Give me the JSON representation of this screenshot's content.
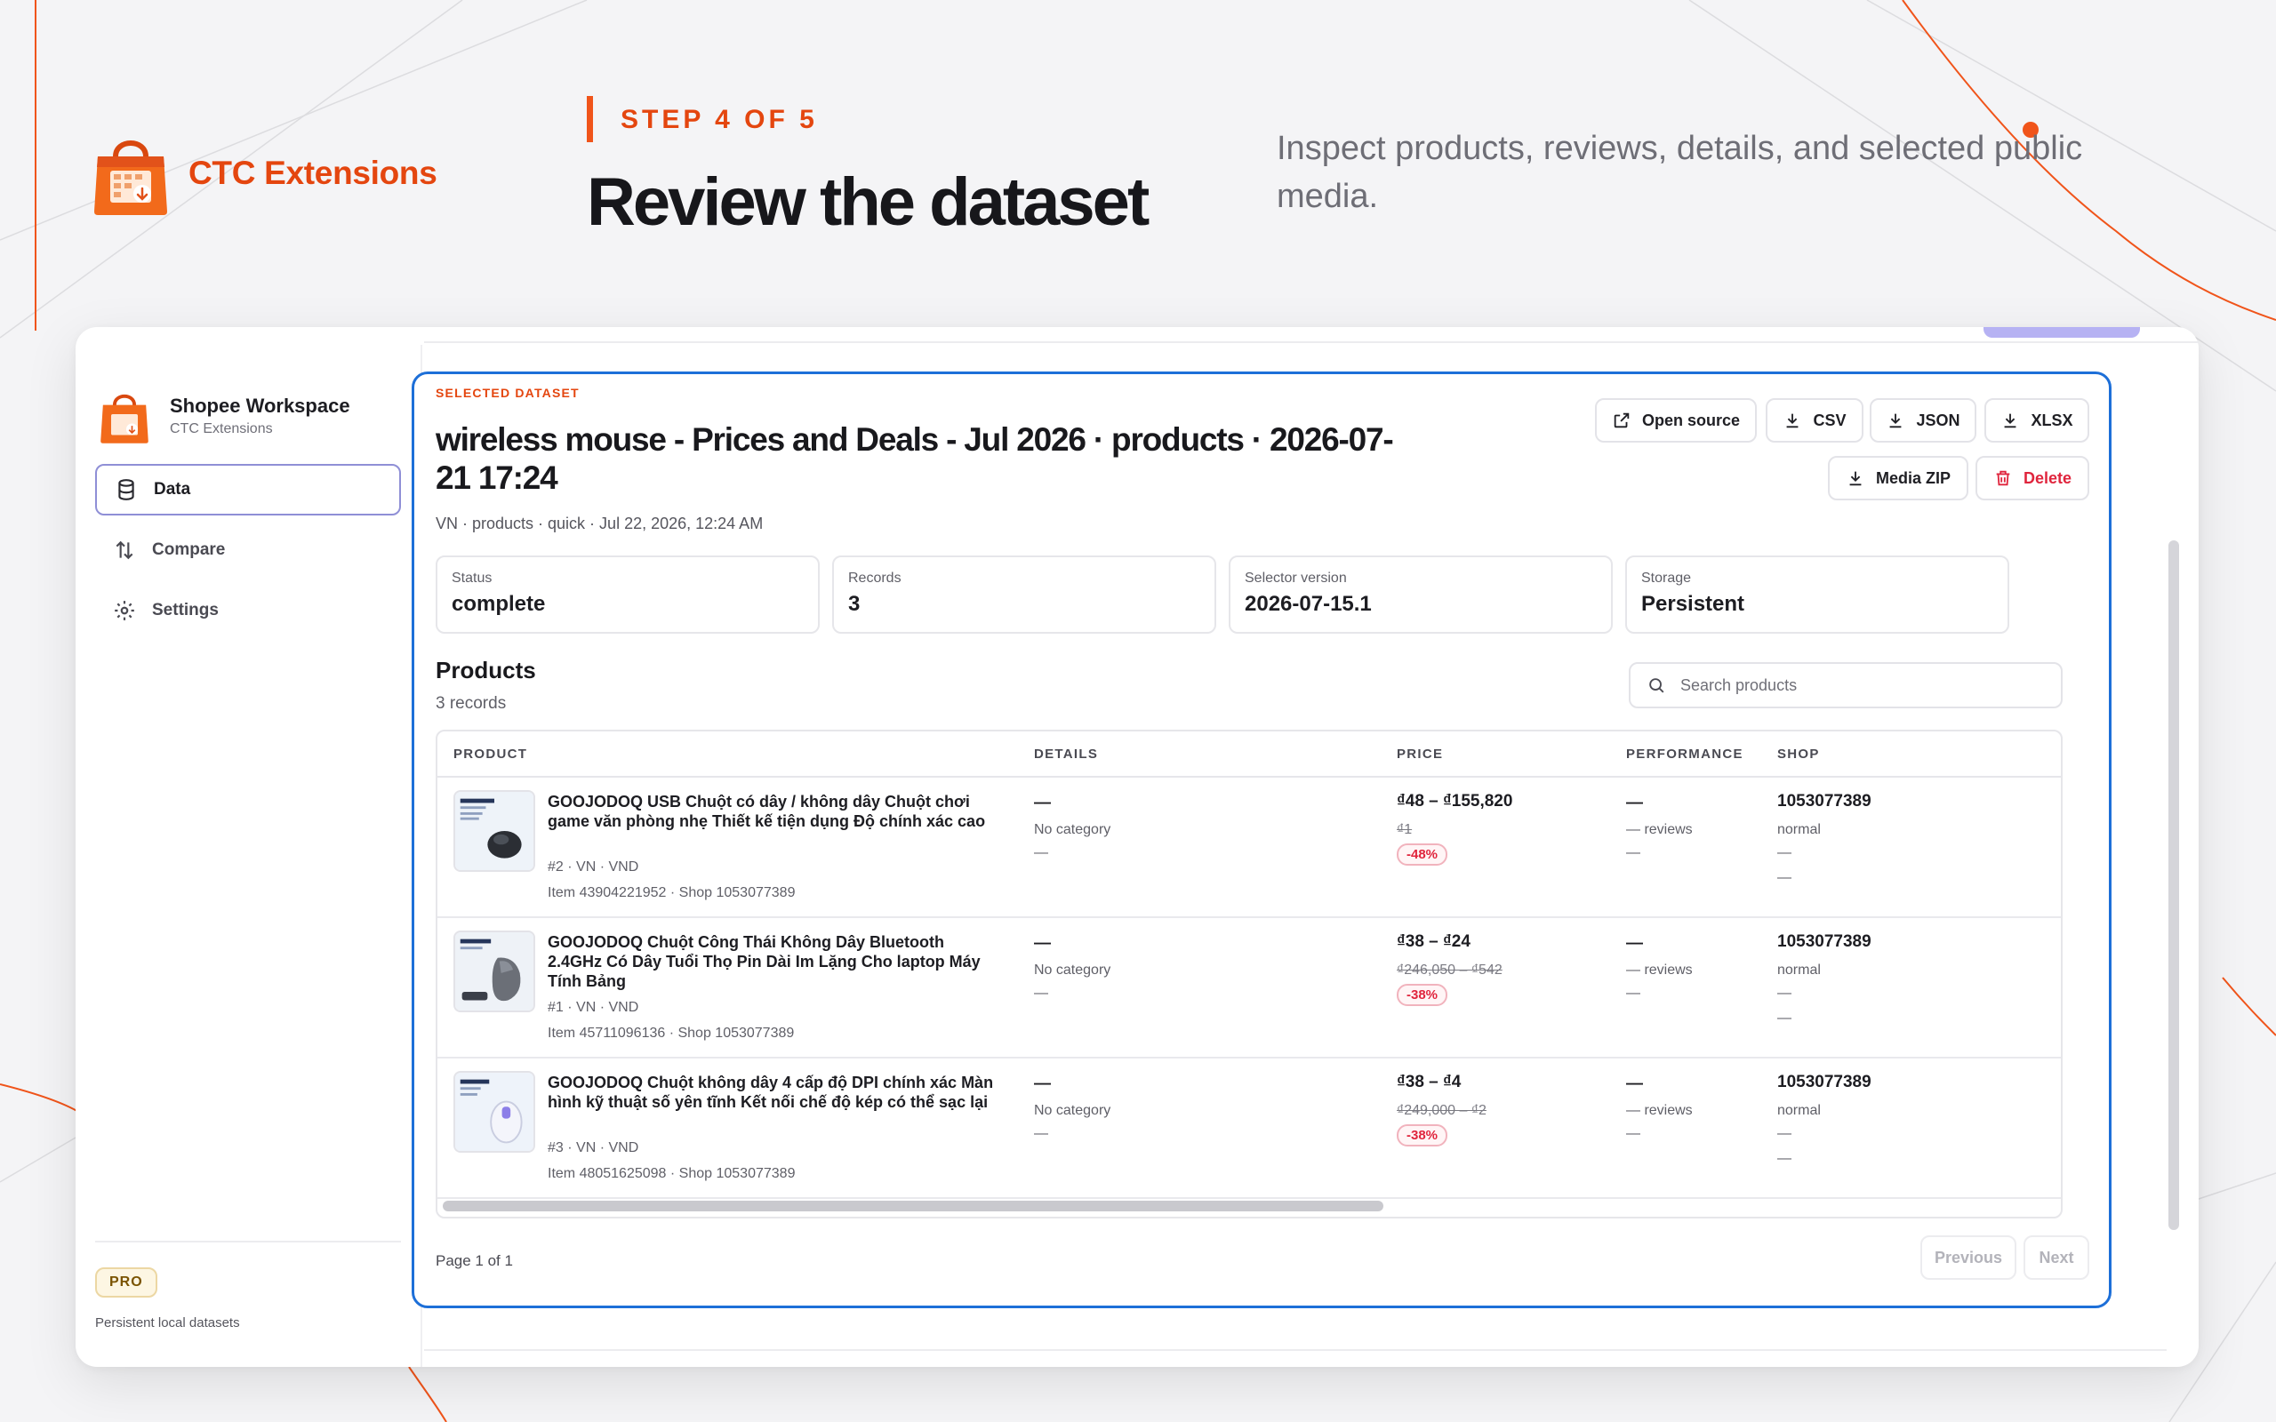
{
  "brand": {
    "name": "CTC Extensions",
    "icon": "shopping-bag-calendar-icon",
    "accent": "#e4460f"
  },
  "promo": {
    "step_label": "STEP 4 OF 5",
    "heading": "Review the dataset",
    "subheading": "Inspect products, reviews, details, and selected public media."
  },
  "sidebar": {
    "workspace_title": "Shopee Workspace",
    "workspace_subtitle": "CTC Extensions",
    "items": [
      {
        "label": "Data",
        "icon": "database-icon",
        "active": true
      },
      {
        "label": "Compare",
        "icon": "compare-arrows-icon",
        "active": false
      },
      {
        "label": "Settings",
        "icon": "gear-icon",
        "active": false
      }
    ],
    "badge": "PRO",
    "note": "Persistent local datasets"
  },
  "dataset": {
    "kicker": "SELECTED DATASET",
    "title": "wireless mouse - Prices and Deals - Jul 2026 · products · 2026-07-21 17:24",
    "meta": "VN · products · quick · Jul 22, 2026, 12:24 AM",
    "actions": {
      "open_source": "Open source",
      "csv": "CSV",
      "json": "JSON",
      "xlsx": "XLSX",
      "media_zip": "Media ZIP",
      "delete": "Delete"
    },
    "stats": [
      {
        "label": "Status",
        "value": "complete"
      },
      {
        "label": "Records",
        "value": "3"
      },
      {
        "label": "Selector version",
        "value": "2026-07-15.1"
      },
      {
        "label": "Storage",
        "value": "Persistent"
      }
    ]
  },
  "products": {
    "heading": "Products",
    "count": "3 records",
    "search_placeholder": "Search products",
    "columns": [
      "PRODUCT",
      "DETAILS",
      "PRICE",
      "PERFORMANCE",
      "SHOP"
    ],
    "rows": [
      {
        "name": "GOOJODOQ USB Chuột có dây / không dây Chuột chơi game văn phòng nhẹ Thiết kế tiện dụng Độ chính xác cao",
        "rank_line": "#2 · VN · VND",
        "ids_line": "Item 43904221952 · Shop 1053077389",
        "details_main": "—",
        "details_category": "No category",
        "details_extra": "—",
        "price": "₫48 – ₫155,820",
        "price_original": "₫1",
        "discount": "-48%",
        "perf_main": "—",
        "perf_reviews": "— reviews",
        "perf_extra": "—",
        "shop_id": "1053077389",
        "shop_type": "normal",
        "shop_extra1": "—",
        "shop_extra2": "—"
      },
      {
        "name": "GOOJODOQ Chuột Công Thái Không Dây Bluetooth 2.4GHz Có Dây Tuổi Thọ Pin Dài Im Lặng Cho laptop Máy Tính Bảng",
        "rank_line": "#1 · VN · VND",
        "ids_line": "Item 45711096136 · Shop 1053077389",
        "details_main": "—",
        "details_category": "No category",
        "details_extra": "—",
        "price": "₫38 – ₫24",
        "price_original": "₫246,050 – ₫542",
        "discount": "-38%",
        "perf_main": "—",
        "perf_reviews": "— reviews",
        "perf_extra": "—",
        "shop_id": "1053077389",
        "shop_type": "normal",
        "shop_extra1": "—",
        "shop_extra2": "—"
      },
      {
        "name": "GOOJODOQ Chuột không dây 4 cấp độ DPI chính xác Màn hình kỹ thuật số yên tĩnh Kết nối chế độ kép có thể sạc lại",
        "rank_line": "#3 · VN · VND",
        "ids_line": "Item 48051625098 · Shop 1053077389",
        "details_main": "—",
        "details_category": "No category",
        "details_extra": "—",
        "price": "₫38 – ₫4",
        "price_original": "₫249,000 – ₫2",
        "discount": "-38%",
        "perf_main": "—",
        "perf_reviews": "— reviews",
        "perf_extra": "—",
        "shop_id": "1053077389",
        "shop_type": "normal",
        "shop_extra1": "—",
        "shop_extra2": "—"
      }
    ],
    "pager": {
      "text": "Page 1 of 1",
      "previous": "Previous",
      "next": "Next"
    }
  },
  "colors": {
    "card_border": "#1d6fd8",
    "danger": "#e0253d",
    "nav_active_border": "#8f8fd6"
  }
}
